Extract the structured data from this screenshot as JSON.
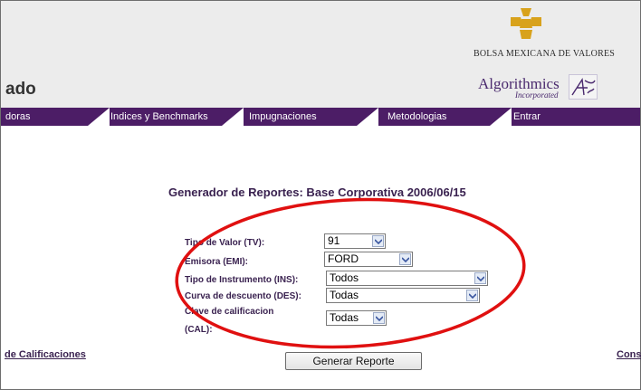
{
  "header": {
    "page_title": "ado",
    "bmv_label": "BOLSA MEXICANA DE VALORES",
    "algorithmics_name": "Algorithmics",
    "algorithmics_sub": "Incorporated"
  },
  "nav": {
    "items": [
      {
        "label": "doras"
      },
      {
        "label": "Indices y Benchmarks"
      },
      {
        "label": "Impugnaciones"
      },
      {
        "label": "Metodologias"
      },
      {
        "label": "Entrar"
      }
    ]
  },
  "main": {
    "report_title": "Generador de Reportes: Base Corporativa 2006/06/15",
    "fields": [
      {
        "label": "Tipo de Valor (TV):",
        "value": "91"
      },
      {
        "label": "Emisora (EMI):",
        "value": "FORD"
      },
      {
        "label": "Tipo de Instrumento (INS):",
        "value": "Todos"
      },
      {
        "label": "Curva de descuento (DES):",
        "value": "Todas"
      },
      {
        "label_line1": "Clave de calificacion",
        "label_line2": "(CAL):",
        "value": "Todas"
      }
    ],
    "left_link": "de Calificaciones",
    "right_link": "Cons",
    "generate_button": "Generar Reporte"
  },
  "colors": {
    "nav_bg": "#4c1d66",
    "header_bg": "#ececec",
    "annotation_oval": "#e01010",
    "logo_gold": "#d8a21c"
  }
}
